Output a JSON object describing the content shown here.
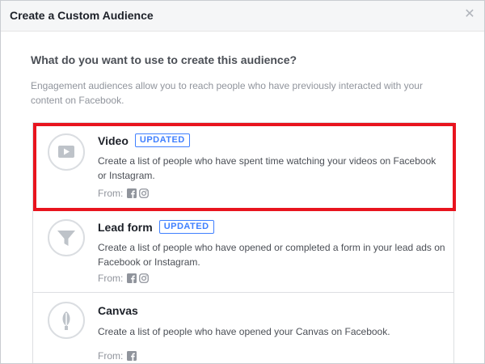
{
  "dialog": {
    "title": "Create a Custom Audience",
    "close_icon": "close-icon"
  },
  "main": {
    "question": "What do you want to use to create this audience?",
    "description": "Engagement audiences allow you to reach people who have previously interacted with your content on Facebook."
  },
  "options": [
    {
      "title": "Video",
      "badge": "UPDATED",
      "description": "Create a list of people who have spent time watching your videos on Facebook or Instagram.",
      "from_label": "From:",
      "sources": [
        "facebook-icon",
        "instagram-icon"
      ],
      "icon": "video-play-icon"
    },
    {
      "title": "Lead form",
      "badge": "UPDATED",
      "description": "Create a list of people who have opened or completed a form in your lead ads on Facebook or Instagram.",
      "from_label": "From:",
      "sources": [
        "facebook-icon",
        "instagram-icon"
      ],
      "icon": "funnel-icon"
    },
    {
      "title": "Canvas",
      "badge": "",
      "description": "Create a list of people who have opened your Canvas on Facebook.",
      "from_label": "From:",
      "sources": [
        "facebook-icon"
      ],
      "icon": "canvas-icon"
    }
  ],
  "colors": {
    "badge": "#4080ff",
    "highlight": "#e8141e",
    "icon_gray": "#bec3c9"
  }
}
